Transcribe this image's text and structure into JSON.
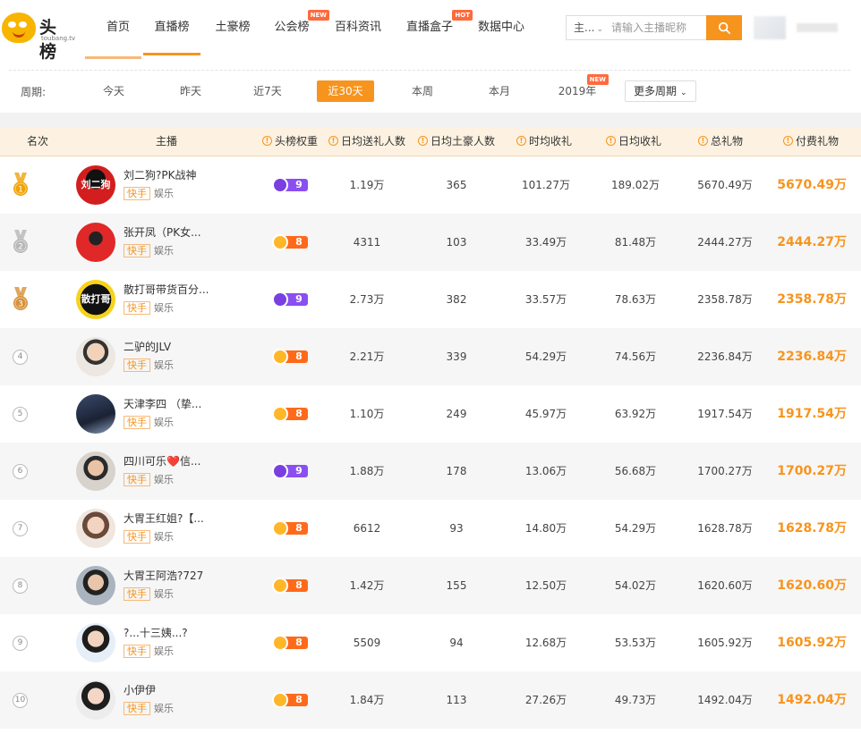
{
  "header": {
    "logo_text": "头榜",
    "logo_sub": "toubang.tv",
    "nav": [
      {
        "label": "首页",
        "badge": ""
      },
      {
        "label": "直播榜",
        "badge": ""
      },
      {
        "label": "土豪榜",
        "badge": ""
      },
      {
        "label": "公会榜",
        "badge": "NEW"
      },
      {
        "label": "百科资讯",
        "badge": ""
      },
      {
        "label": "直播盒子",
        "badge": "HOT"
      },
      {
        "label": "数据中心",
        "badge": ""
      }
    ],
    "search": {
      "type": "主...",
      "placeholder": "请输入主播昵称"
    }
  },
  "period": {
    "label": "周期:",
    "options": [
      {
        "label": "今天",
        "badge": ""
      },
      {
        "label": "昨天",
        "badge": ""
      },
      {
        "label": "近7天",
        "badge": ""
      },
      {
        "label": "近30天",
        "badge": ""
      },
      {
        "label": "本周",
        "badge": ""
      },
      {
        "label": "本月",
        "badge": ""
      },
      {
        "label": "2019年",
        "badge": "NEW"
      }
    ],
    "active": "近30天",
    "more_label": "更多周期"
  },
  "table": {
    "columns": [
      "名次",
      "主播",
      "头榜权重",
      "日均送礼人数",
      "日均土豪人数",
      "时均收礼",
      "日均收礼",
      "总礼物",
      "付费礼物"
    ],
    "info_columns": [
      2,
      3,
      4,
      5,
      6,
      7,
      8
    ],
    "rows": [
      {
        "rank": "1",
        "name": "刘二狗?PK战神",
        "avatar_text": "刘二狗",
        "platform": "快手",
        "category": "娱乐",
        "weight": "9",
        "weight_color": "#8a4ff0",
        "givers": "1.19万",
        "tycoons": "365",
        "hourly": "101.27万",
        "daily": "189.02万",
        "total": "5670.49万",
        "paid": "5670.49万"
      },
      {
        "rank": "2",
        "name": "张开凤（PK女...",
        "avatar_text": "",
        "platform": "快手",
        "category": "娱乐",
        "weight": "8",
        "weight_color": "#ff6a1a",
        "givers": "4311",
        "tycoons": "103",
        "hourly": "33.49万",
        "daily": "81.48万",
        "total": "2444.27万",
        "paid": "2444.27万"
      },
      {
        "rank": "3",
        "name": "散打哥带货百分...",
        "avatar_text": "散打哥",
        "platform": "快手",
        "category": "娱乐",
        "weight": "9",
        "weight_color": "#8a4ff0",
        "givers": "2.73万",
        "tycoons": "382",
        "hourly": "33.57万",
        "daily": "78.63万",
        "total": "2358.78万",
        "paid": "2358.78万"
      },
      {
        "rank": "4",
        "name": "二驴的JLV",
        "avatar_text": "",
        "platform": "快手",
        "category": "娱乐",
        "weight": "8",
        "weight_color": "#ff6a1a",
        "givers": "2.21万",
        "tycoons": "339",
        "hourly": "54.29万",
        "daily": "74.56万",
        "total": "2236.84万",
        "paid": "2236.84万"
      },
      {
        "rank": "5",
        "name": "天津李四 （挚...",
        "avatar_text": "",
        "platform": "快手",
        "category": "娱乐",
        "weight": "8",
        "weight_color": "#ff6a1a",
        "givers": "1.10万",
        "tycoons": "249",
        "hourly": "45.97万",
        "daily": "63.92万",
        "total": "1917.54万",
        "paid": "1917.54万"
      },
      {
        "rank": "6",
        "name": "四川可乐❤️信...",
        "avatar_text": "",
        "platform": "快手",
        "category": "娱乐",
        "weight": "9",
        "weight_color": "#8a4ff0",
        "givers": "1.88万",
        "tycoons": "178",
        "hourly": "13.06万",
        "daily": "56.68万",
        "total": "1700.27万",
        "paid": "1700.27万"
      },
      {
        "rank": "7",
        "name": "大胃王红姐?【...",
        "avatar_text": "",
        "platform": "快手",
        "category": "娱乐",
        "weight": "8",
        "weight_color": "#ff6a1a",
        "givers": "6612",
        "tycoons": "93",
        "hourly": "14.80万",
        "daily": "54.29万",
        "total": "1628.78万",
        "paid": "1628.78万"
      },
      {
        "rank": "8",
        "name": "大胃王阿浩?727",
        "avatar_text": "",
        "platform": "快手",
        "category": "娱乐",
        "weight": "8",
        "weight_color": "#ff6a1a",
        "givers": "1.42万",
        "tycoons": "155",
        "hourly": "12.50万",
        "daily": "54.02万",
        "total": "1620.60万",
        "paid": "1620.60万"
      },
      {
        "rank": "9",
        "name": "?...十三姨...?",
        "avatar_text": "",
        "platform": "快手",
        "category": "娱乐",
        "weight": "8",
        "weight_color": "#ff6a1a",
        "givers": "5509",
        "tycoons": "94",
        "hourly": "12.68万",
        "daily": "53.53万",
        "total": "1605.92万",
        "paid": "1605.92万"
      },
      {
        "rank": "10",
        "name": "小伊伊",
        "avatar_text": "",
        "platform": "快手",
        "category": "娱乐",
        "weight": "8",
        "weight_color": "#ff6a1a",
        "givers": "1.84万",
        "tycoons": "113",
        "hourly": "27.26万",
        "daily": "49.73万",
        "total": "1492.04万",
        "paid": "1492.04万"
      }
    ]
  },
  "colors": {
    "accent": "#f7941d",
    "header_bg": "#fdf2e1",
    "badge": "#ff6a3d",
    "gold": "#f0a30a",
    "silver": "#b8b8b8",
    "bronze": "#d7913a"
  },
  "icons": {
    "search": "search-icon",
    "chevron": "chevron-down-icon",
    "info": "info-icon",
    "medal": "medal-icon"
  }
}
